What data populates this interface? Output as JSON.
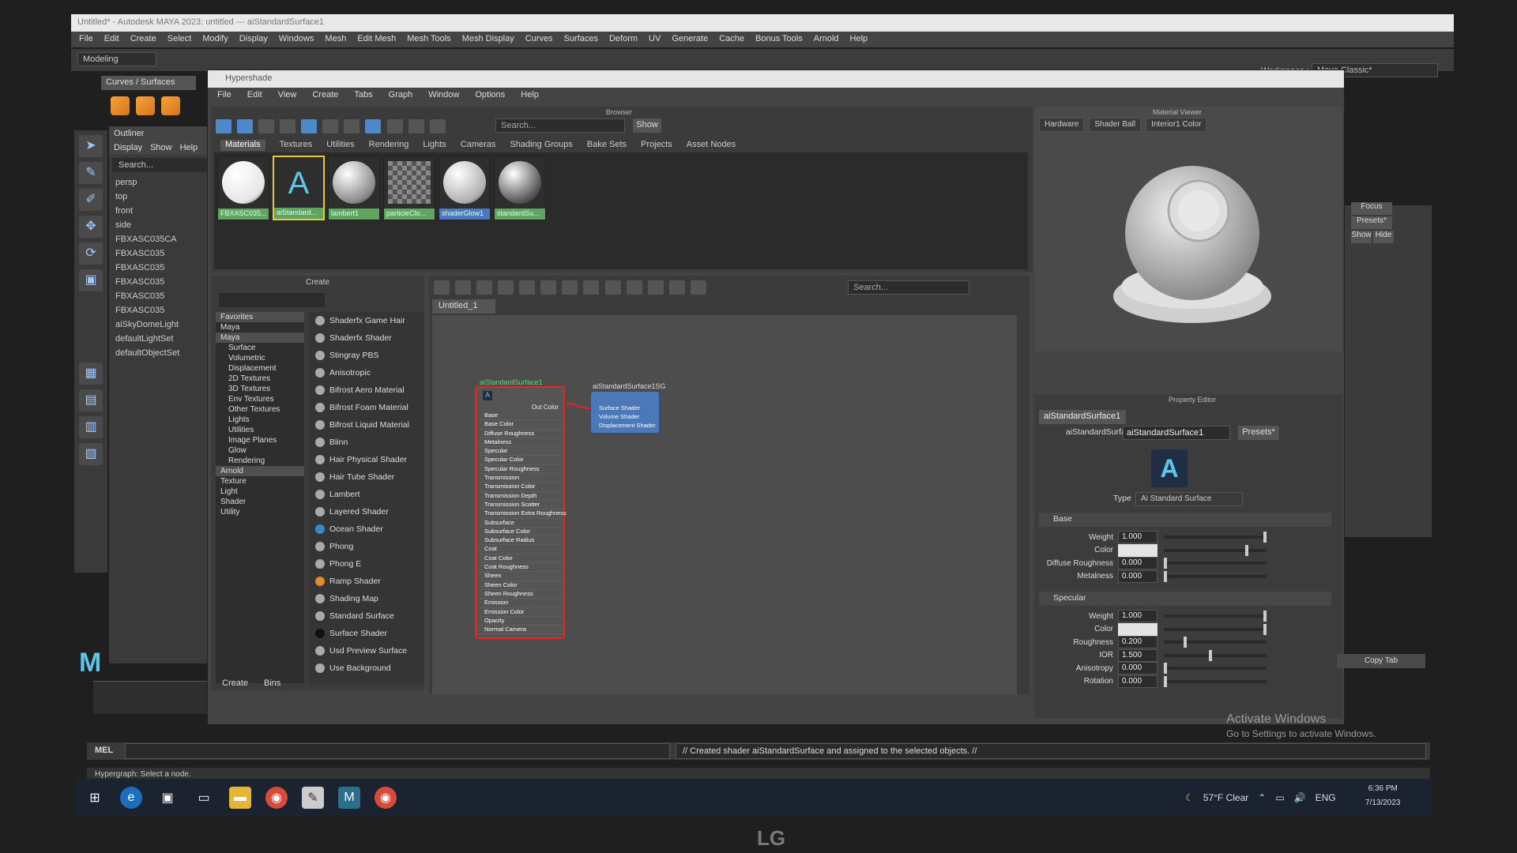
{
  "maya": {
    "title": "Untitled* - Autodesk MAYA 2023: untitled --- aiStandardSurface1",
    "menus": [
      "File",
      "Edit",
      "Create",
      "Select",
      "Modify",
      "Display",
      "Windows",
      "Mesh",
      "Edit Mesh",
      "Mesh Tools",
      "Mesh Display",
      "Curves",
      "Surfaces",
      "Deform",
      "UV",
      "Generate",
      "Cache",
      "Bonus Tools",
      "Arnold",
      "Help"
    ],
    "mode": "Modeling",
    "workspace_label": "Workspace :",
    "workspace": "Maya Classic*",
    "shelf_tab": "Curves / Surfaces"
  },
  "outliner": {
    "title": "Outliner",
    "menu": [
      "Display",
      "Show",
      "Help"
    ],
    "search": "Search...",
    "items": [
      "persp",
      "top",
      "front",
      "side",
      "FBXASC035CA",
      "FBXASC035",
      "FBXASC035",
      "FBXASC035",
      "FBXASC035",
      "FBXASC035",
      "aiSkyDomeLight",
      "defaultLightSet",
      "defaultObjectSet"
    ]
  },
  "hypershade": {
    "title": "Hypershade",
    "menus": [
      "File",
      "Edit",
      "View",
      "Create",
      "Tabs",
      "Graph",
      "Window",
      "Options",
      "Help"
    ]
  },
  "browser": {
    "label": "Browser",
    "search": "Search...",
    "show": "Show",
    "tabs": [
      "Materials",
      "Textures",
      "Utilities",
      "Rendering",
      "Lights",
      "Cameras",
      "Shading Groups",
      "Bake Sets",
      "Projects",
      "Asset Nodes"
    ],
    "swatches": [
      {
        "name": "FBXASC035...",
        "color": "#e6e6e6"
      },
      {
        "name": "aiStandard...",
        "color": "#2e2e2e"
      },
      {
        "name": "lambert1",
        "color": "#8a8a8a"
      },
      {
        "name": "particleClo...",
        "color": "#3aa8d8"
      },
      {
        "name": "shaderGlow1",
        "color": "#b0b0b0"
      },
      {
        "name": "standardSu...",
        "color": "#555555"
      }
    ]
  },
  "create": {
    "title": "Create",
    "categories": [
      "Favorites",
      "Maya",
      "Maya",
      "Surface",
      "Volumetric",
      "Displacement",
      "2D Textures",
      "3D Textures",
      "Env Textures",
      "Other Textures",
      "Lights",
      "Utilities",
      "Image Planes",
      "Glow",
      "Rendering",
      "Arnold",
      "Texture",
      "Light",
      "Shader",
      "Utility"
    ],
    "shaders": [
      "Shaderfx Game Hair",
      "Shaderfx Shader",
      "Stingray PBS",
      "Anisotropic",
      "Bifrost Aero Material",
      "Bifrost Foam Material",
      "Bifrost Liquid Material",
      "Blinn",
      "Hair Physical Shader",
      "Hair Tube Shader",
      "Lambert",
      "Layered Shader",
      "Ocean Shader",
      "Phong",
      "Phong E",
      "Ramp Shader",
      "Shading Map",
      "Standard Surface",
      "Surface Shader",
      "Usd Preview Surface",
      "Use Background"
    ],
    "tabs": [
      "Create",
      "Bins"
    ]
  },
  "graph": {
    "search": "Search...",
    "tab": "Untitled_1",
    "node_main": {
      "title": "aiStandardSurface1",
      "out": "Out Color",
      "attrs": [
        "Base",
        "Base Color",
        "Diffuse Roughness",
        "Metalness",
        "Specular",
        "Specular Color",
        "Specular Roughness",
        "Transmission",
        "Transmission Color",
        "Transmission Depth",
        "Transmission Scatter",
        "Transmission Extra Roughness",
        "Subsurface",
        "Subsurface Color",
        "Subsurface Radius",
        "Coat",
        "Coat Color",
        "Coat Roughness",
        "Sheen",
        "Sheen Color",
        "Sheen Roughness",
        "Emission",
        "Emission Color",
        "Opacity",
        "Normal Camera"
      ]
    },
    "node_sg": {
      "title": "aiStandardSurface1SG",
      "attrs": [
        "Surface Shader",
        "Volume Shader",
        "Displacement Shader"
      ]
    }
  },
  "material_viewer": {
    "label": "Material Viewer",
    "renderer": "Hardware",
    "shape": "Shader Ball",
    "env": "Interior1 Color"
  },
  "property_editor": {
    "label": "Property Editor",
    "tab": "aiStandardSurface1",
    "name_label": "aiStandardSurface:",
    "name": "aiStandardSurface1",
    "presets": "Presets*",
    "type_label": "Type",
    "type": "Ai Standard Surface",
    "base_section": "Base",
    "specular_section": "Specular",
    "base": [
      {
        "label": "Weight",
        "value": "1.000",
        "level": 1.0
      },
      {
        "label": "Color",
        "value": "",
        "level": 0.82
      },
      {
        "label": "Diffuse Roughness",
        "value": "0.000",
        "level": 0.0
      },
      {
        "label": "Metalness",
        "value": "0.000",
        "level": 0.0
      }
    ],
    "specular": [
      {
        "label": "Weight",
        "value": "1.000",
        "level": 1.0
      },
      {
        "label": "Color",
        "value": "",
        "level": 1.0
      },
      {
        "label": "Roughness",
        "value": "0.200",
        "level": 0.2
      },
      {
        "label": "IOR",
        "value": "1.500",
        "level": 0.45
      },
      {
        "label": "Anisotropy",
        "value": "0.000",
        "level": 0.0
      },
      {
        "label": "Rotation",
        "value": "0.000",
        "level": 0.0
      }
    ]
  },
  "side": {
    "focus": "Focus",
    "presets": "Presets*",
    "show": "Show",
    "hide": "Hide",
    "copy_tab": "Copy Tab"
  },
  "mel": {
    "label": "MEL",
    "result": "// Created shader aiStandardSurface and assigned to the selected objects. //",
    "help": "Hypergraph: Select a node."
  },
  "activate": {
    "line1": "Activate Windows",
    "line2": "Go to Settings to activate Windows."
  },
  "taskbar": {
    "weather": "57°F  Clear",
    "lang": "ENG",
    "time": "6:36 PM",
    "date": "7/13/2023"
  },
  "monitor_brand": "LG"
}
